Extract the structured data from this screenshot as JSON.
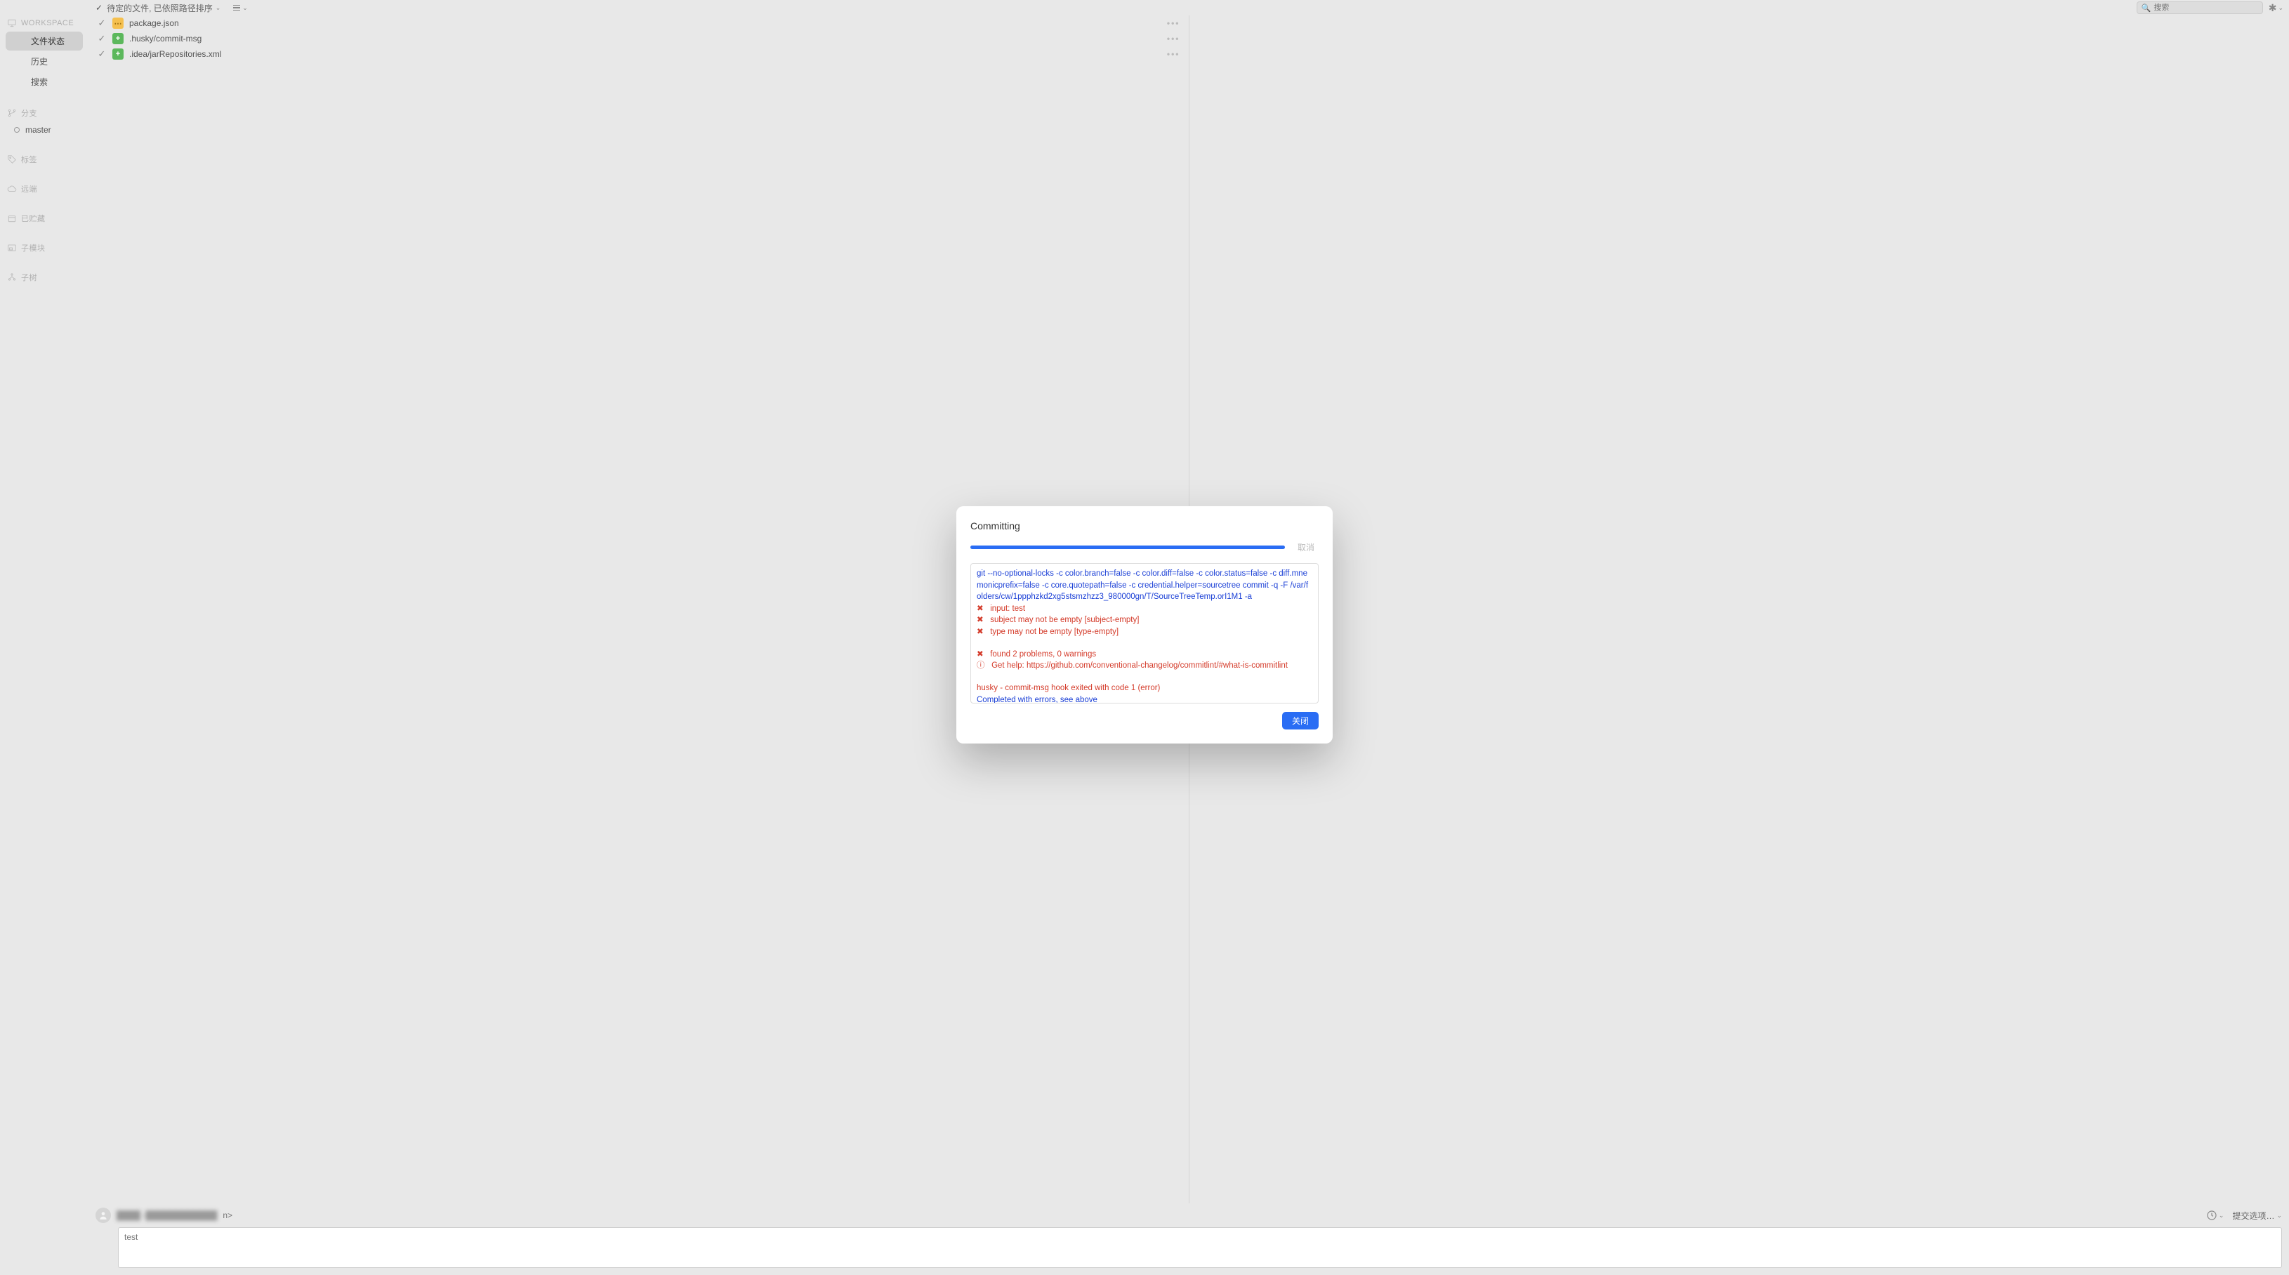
{
  "topbar": {
    "check_label": "✓",
    "sort_label": "待定的文件, 已依照路径排序",
    "search_placeholder": "搜索"
  },
  "sidebar": {
    "workspace_label": "WORKSPACE",
    "items": {
      "file_status": "文件状态",
      "history": "历史",
      "search": "搜索"
    },
    "branches_label": "分支",
    "branch_master": "master",
    "tags_label": "标签",
    "remotes_label": "远端",
    "stashed_label": "已贮藏",
    "submodules_label": "子模块",
    "subtrees_label": "子树"
  },
  "files": [
    {
      "name": "package.json",
      "icon": "folder"
    },
    {
      "name": ".husky/commit-msg",
      "icon": "add"
    },
    {
      "name": ".idea/jarRepositories.xml",
      "icon": "add"
    }
  ],
  "commit": {
    "author_suffix": "n>",
    "options_label": "提交选项…",
    "message": "test"
  },
  "modal": {
    "title": "Committing",
    "cancel_label": "取消",
    "close_label": "关闭",
    "log": {
      "cmd": "git --no-optional-locks -c color.branch=false -c color.diff=false -c color.status=false -c diff.mnemonicprefix=false -c core.quotepath=false -c credential.helper=sourcetree commit -q -F /var/folders/cw/1ppphzkd2xg5stsmzhzz3_980000gn/T/SourceTreeTemp.orI1M1 -a",
      "err1": "✖   input: test",
      "err2": "✖   subject may not be empty [subject-empty]",
      "err3": "✖   type may not be empty [type-empty]",
      "err4": "✖   found 2 problems, 0 warnings",
      "err5": "ⓘ   Get help: https://github.com/conventional-changelog/commitlint/#what-is-commitlint",
      "err6": "husky - commit-msg hook exited with code 1 (error)",
      "done": "Completed with errors, see above"
    }
  }
}
